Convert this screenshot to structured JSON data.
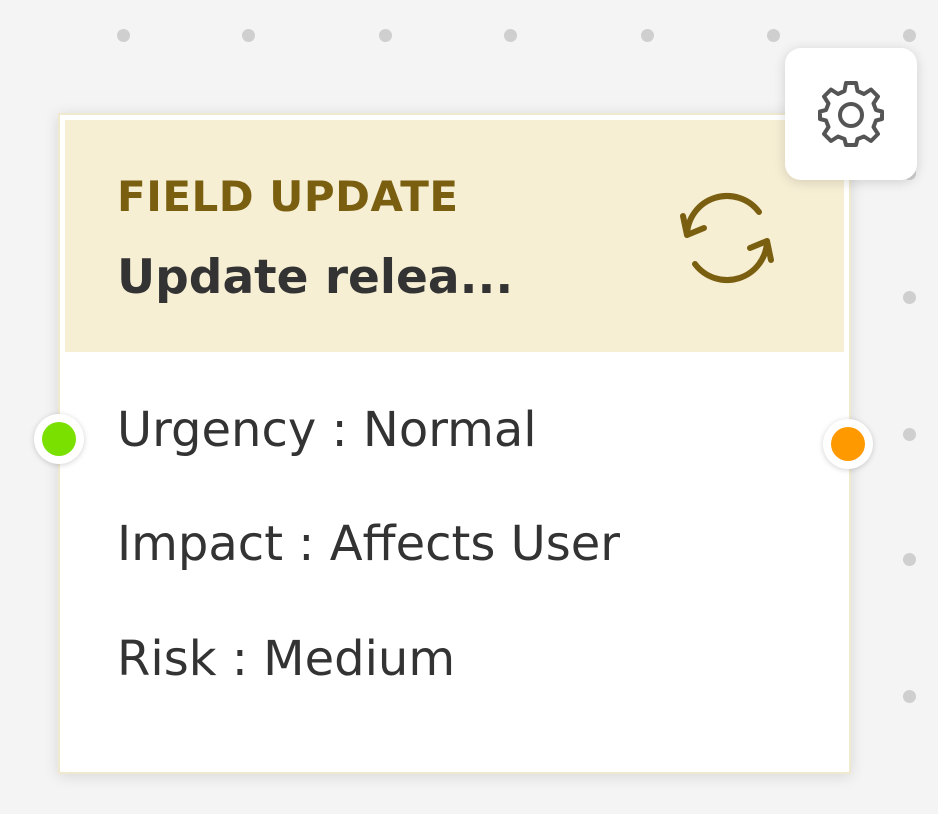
{
  "node": {
    "type_label": "FIELD UPDATE",
    "title": "Update relea...",
    "fields": [
      {
        "text": "Urgency : Normal"
      },
      {
        "text": "Impact : Affects User"
      },
      {
        "text": "Risk : Medium"
      }
    ],
    "icon": "refresh-icon"
  },
  "toolbar": {
    "settings_icon": "gear-icon"
  },
  "ports": {
    "input_color": "#7ae000",
    "output_color": "#ff9900"
  },
  "colors": {
    "header_bg": "#f7efd4",
    "type_label": "#7a5f10",
    "text": "#333333"
  }
}
